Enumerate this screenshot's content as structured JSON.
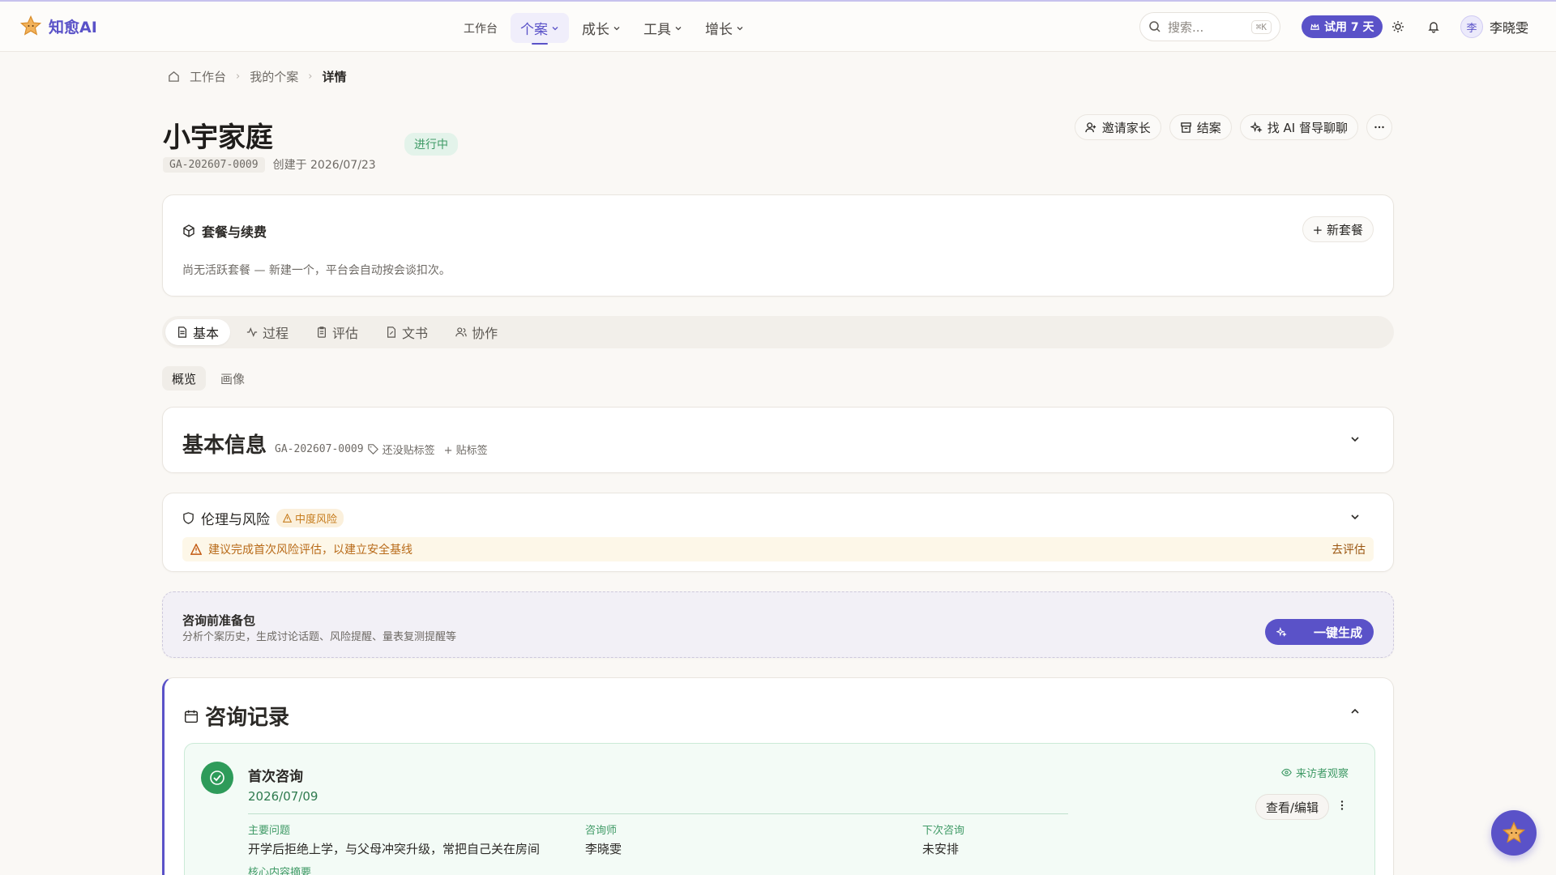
{
  "brand": {
    "name": "知愈AI"
  },
  "nav": {
    "items": [
      {
        "label": "工作台"
      },
      {
        "label": "个案"
      },
      {
        "label": "成长"
      },
      {
        "label": "工具"
      },
      {
        "label": "增长"
      }
    ]
  },
  "header": {
    "search_placeholder": "搜索...",
    "search_shortcut": "⌘K",
    "trial_label": "试用 7 天",
    "user_avatar": "李",
    "user_name": "李晓雯"
  },
  "breadcrumb": [
    "工作台",
    "我的个案",
    "详情"
  ],
  "case": {
    "title": "小宇家庭",
    "status": "进行中",
    "code": "GA-202607-0009",
    "created": "创建于 2026/07/23"
  },
  "actions": {
    "invite": "邀请家长",
    "close": "结案",
    "ai": "找 AI 督导聊聊"
  },
  "package": {
    "title": "套餐与续费",
    "desc": "尚无活跃套餐 — 新建一个，平台会自动按会谈扣次。",
    "add_label": "+ 新套餐"
  },
  "tabs": [
    "基本",
    "过程",
    "评估",
    "文书",
    "协作"
  ],
  "subtabs": [
    "概览",
    "画像"
  ],
  "basic": {
    "title": "基本信息",
    "code": "GA-202607-0009",
    "no_tag": "还没贴标签",
    "add_tag": "+ 贴标签"
  },
  "ethics": {
    "title": "伦理与风险",
    "risk": "中度风险",
    "warning": "建议完成首次风险评估，以建立安全基线",
    "action": "去评估"
  },
  "prep": {
    "title": "咨询前准备包",
    "desc": "分析个案历史，生成讨论话题、风险提醒、量表复测提醒等",
    "button": "一键生成"
  },
  "records": {
    "title": "咨询记录",
    "session": {
      "title": "首次咨询",
      "date": "2026/07/09",
      "observer": "来访者观察",
      "edit": "查看/编辑",
      "fields": [
        {
          "label": "主要问题",
          "value": "开学后拒绝上学，与父母冲突升级，常把自己关在房间"
        },
        {
          "label": "咨询师",
          "value": "李晓雯"
        },
        {
          "label": "下次咨询",
          "value": "未安排"
        }
      ],
      "core_label": "核心内容摘要"
    }
  },
  "colors": {
    "accent": "#5a52c8",
    "success": "#2e9b5a",
    "warning": "#c67c1e"
  }
}
